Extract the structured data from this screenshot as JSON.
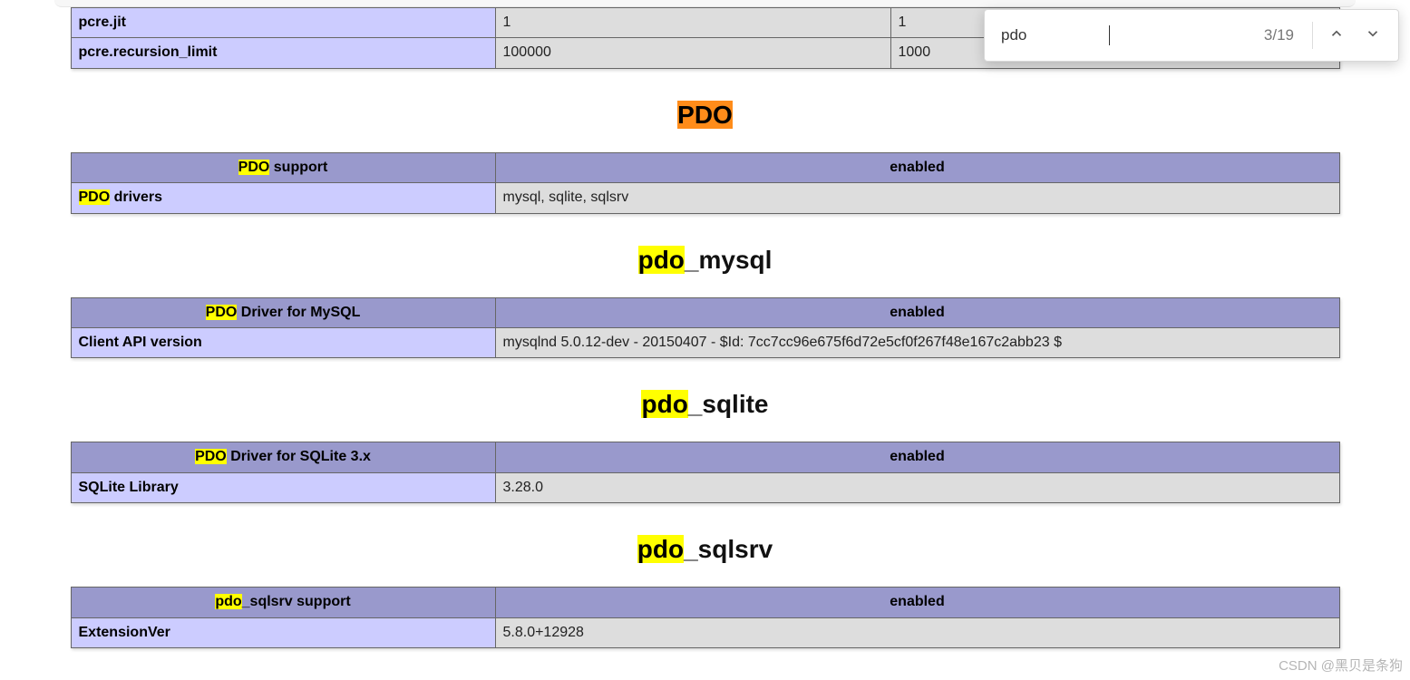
{
  "find": {
    "query": "pdo",
    "count_label": "3/19"
  },
  "top_config_rows": [
    {
      "name": "pcre.jit",
      "local": "1",
      "master": "1"
    },
    {
      "name": "pcre.recursion_limit",
      "local": "100000",
      "master": "1000"
    }
  ],
  "sections": [
    {
      "id": "pdo",
      "heading": {
        "hl": "PDO",
        "rest": "",
        "active": true
      },
      "header_row": {
        "left_hl": "PDO",
        "left_rest": " support",
        "right": "enabled"
      },
      "rows": [
        {
          "name_hl": "PDO",
          "name_rest": " drivers",
          "value": "mysql, sqlite, sqlsrv"
        }
      ]
    },
    {
      "id": "pdo_mysql",
      "heading": {
        "hl": "pdo",
        "rest": "_mysql",
        "active": false
      },
      "header_row": {
        "left_hl": "PDO",
        "left_rest": " Driver for MySQL",
        "right": "enabled"
      },
      "rows": [
        {
          "name_hl": "",
          "name_rest": "Client API version",
          "value": "mysqlnd 5.0.12-dev - 20150407 - $Id: 7cc7cc96e675f6d72e5cf0f267f48e167c2abb23 $"
        }
      ]
    },
    {
      "id": "pdo_sqlite",
      "heading": {
        "hl": "pdo",
        "rest": "_sqlite",
        "active": false
      },
      "header_row": {
        "left_hl": "PDO",
        "left_rest": " Driver for SQLite 3.x",
        "right": "enabled"
      },
      "rows": [
        {
          "name_hl": "",
          "name_rest": "SQLite Library",
          "value": "3.28.0"
        }
      ]
    },
    {
      "id": "pdo_sqlsrv",
      "heading": {
        "hl": "pdo",
        "rest": "_sqlsrv",
        "active": false
      },
      "header_row": {
        "left_hl": "pdo",
        "left_rest": "_sqlsrv support",
        "right": "enabled"
      },
      "rows": [
        {
          "name_hl": "",
          "name_rest": "ExtensionVer",
          "value": "5.8.0+12928"
        }
      ]
    }
  ],
  "watermark": "CSDN @黑贝是条狗"
}
